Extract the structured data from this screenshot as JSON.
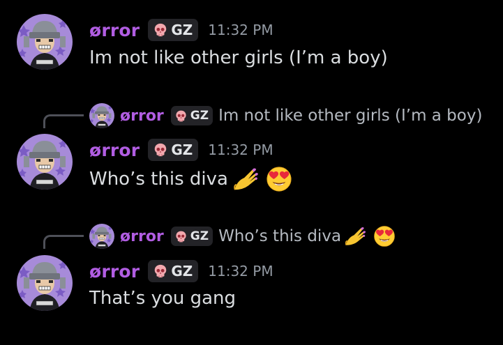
{
  "messages": [
    {
      "author": "ørror",
      "tag": "GZ",
      "time": "11:32 PM",
      "text": "Im not like other girls (I’m a boy)",
      "emojis": []
    },
    {
      "author": "ørror",
      "tag": "GZ",
      "time": "11:32 PM",
      "text": "Who’s this diva",
      "emojis": [
        "nail-polish-emoji",
        "heart-eyes-emoji"
      ],
      "reply": {
        "author": "ørror",
        "tag": "GZ",
        "text": "Im not like other girls (I’m a boy)",
        "emojis": []
      }
    },
    {
      "author": "ørror",
      "tag": "GZ",
      "time": "11:32 PM",
      "text": "That’s you gang",
      "emojis": [],
      "reply": {
        "author": "ørror",
        "tag": "GZ",
        "text": "Who’s this diva",
        "emojis": [
          "nail-polish-emoji",
          "heart-eyes-emoji"
        ]
      }
    }
  ],
  "colors": {
    "background": "#000000",
    "username": "#b15de2",
    "message_text": "#dbdee1",
    "timestamp": "#949ba4",
    "tag_background": "#232327",
    "reply_spine": "#4e5058",
    "avatar_background": "#a78bd9"
  },
  "icons": {
    "tag": "skull-icon",
    "avatar": "pixel-art-avatar"
  }
}
